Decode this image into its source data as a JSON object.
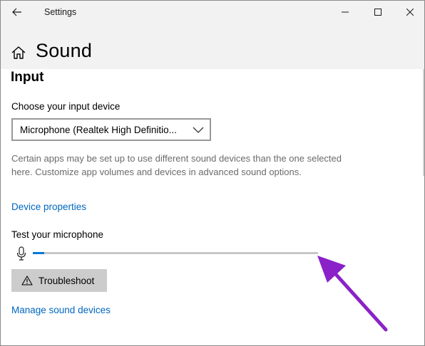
{
  "window": {
    "title": "Settings",
    "controls": {
      "minimize": "minimize-icon",
      "maximize": "maximize-icon",
      "close": "close-icon"
    }
  },
  "header": {
    "back_icon": "back-arrow-icon",
    "home_icon": "home-icon",
    "title": "Sound"
  },
  "input_section": {
    "title": "Input",
    "device_label": "Choose your input device",
    "device_selected": "Microphone (Realtek High Definitio...",
    "description": "Certain apps may be set up to use different sound devices than the one selected here. Customize app volumes and devices in advanced sound options.",
    "device_properties_link": "Device properties",
    "test_label": "Test your microphone",
    "mic_level": 0.04,
    "troubleshoot_label": "Troubleshoot",
    "manage_link": "Manage sound devices"
  },
  "colors": {
    "accent": "#0078d7",
    "link": "#0067c0",
    "annotation_arrow": "#8a22c8"
  }
}
